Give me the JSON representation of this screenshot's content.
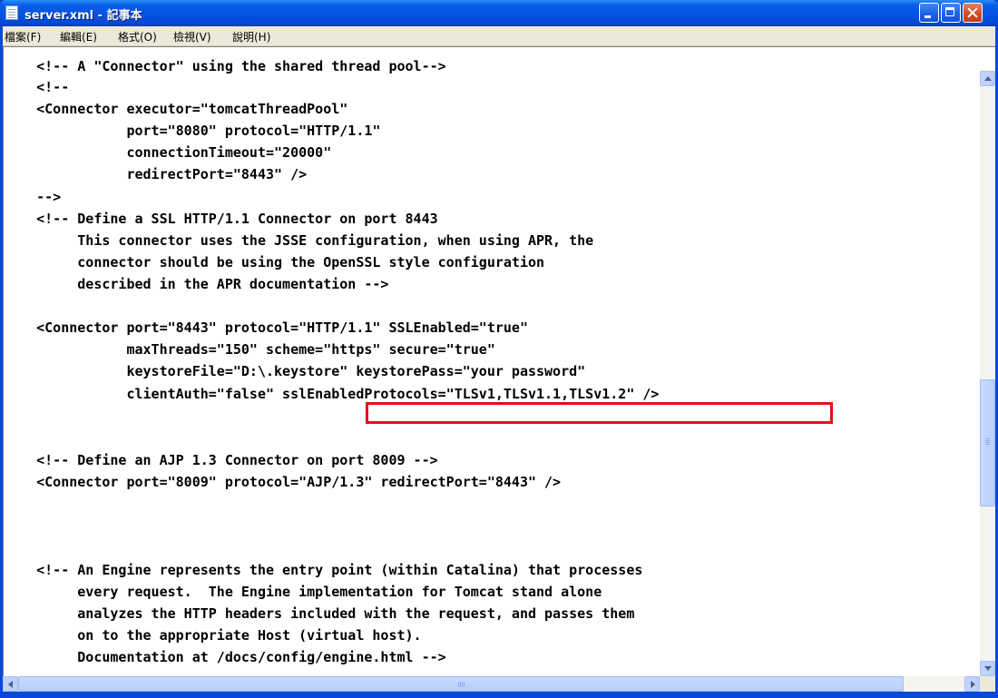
{
  "window": {
    "title": "server.xml - 記事本"
  },
  "menu": {
    "items": [
      "檔案(F)",
      "編輯(E)",
      "格式(O)",
      "檢視(V)",
      "說明(H)"
    ]
  },
  "editor": {
    "lines": [
      "    <!-- A \"Connector\" using the shared thread pool-->",
      "    <!--",
      "    <Connector executor=\"tomcatThreadPool\"",
      "               port=\"8080\" protocol=\"HTTP/1.1\"",
      "               connectionTimeout=\"20000\"",
      "               redirectPort=\"8443\" />",
      "    -->",
      "    <!-- Define a SSL HTTP/1.1 Connector on port 8443",
      "         This connector uses the JSSE configuration, when using APR, the",
      "         connector should be using the OpenSSL style configuration",
      "         described in the APR documentation -->",
      "",
      "    <Connector port=\"8443\" protocol=\"HTTP/1.1\" SSLEnabled=\"true\"",
      "               maxThreads=\"150\" scheme=\"https\" secure=\"true\"",
      "               keystoreFile=\"D:\\.keystore\" keystorePass=\"your password\"",
      "               clientAuth=\"false\" sslEnabledProtocols=\"TLSv1,TLSv1.1,TLSv1.2\" />",
      "",
      "",
      "    <!-- Define an AJP 1.3 Connector on port 8009 -->",
      "    <Connector port=\"8009\" protocol=\"AJP/1.3\" redirectPort=\"8443\" />",
      "",
      "",
      "",
      "    <!-- An Engine represents the entry point (within Catalina) that processes",
      "         every request.  The Engine implementation for Tomcat stand alone",
      "         analyzes the HTTP headers included with the request, and passes them",
      "         on to the appropriate Host (virtual host).",
      "         Documentation at /docs/config/engine.html -->"
    ]
  },
  "colors": {
    "titlebar": "#0454e4",
    "highlight": "#e3101a",
    "menubar": "#ece9d8"
  }
}
